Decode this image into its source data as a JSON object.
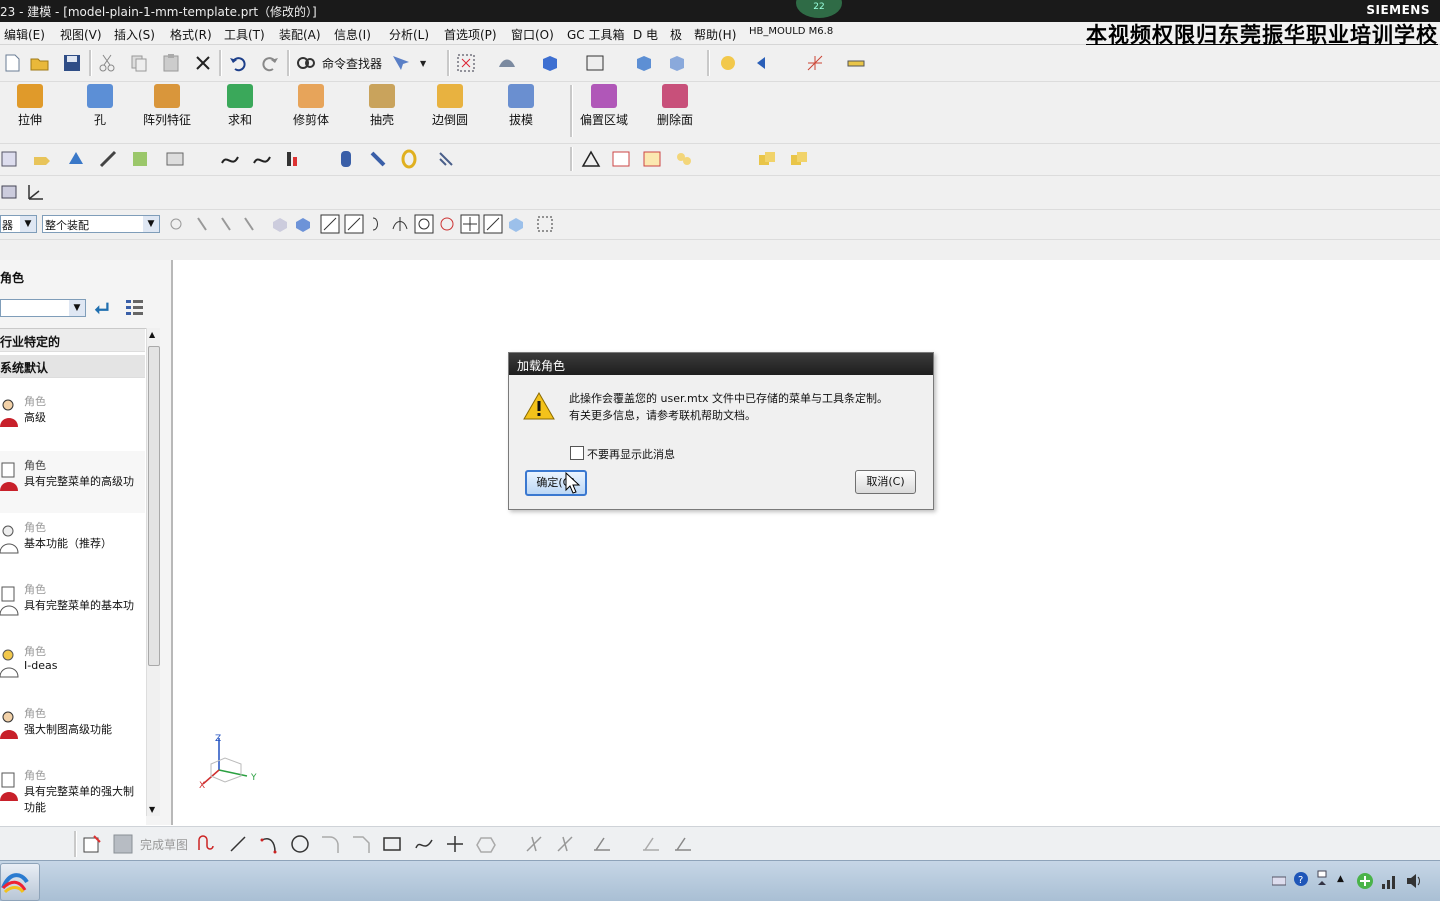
{
  "window": {
    "title": "23 - 建模 - [model-plain-1-mm-template.prt（修改的）]",
    "brand": "SIEMENS",
    "orb_badge": "22"
  },
  "watermark": "本视频权限归东莞振华职业培训学校",
  "menu": [
    "编辑(E)",
    "视图(V)",
    "插入(S)",
    "格式(R)",
    "工具(T)",
    "装配(A)",
    "信息(I)",
    "分析(L)",
    "首选项(P)",
    "窗口(O)",
    "GC 工具箱",
    "D 电",
    "极",
    "帮助(H)",
    "HB_MOULD M6.8"
  ],
  "standard_toolbar": {
    "command_finder_label": "命令查找器"
  },
  "feature_toolbar": [
    {
      "label": "拉伸",
      "color": "#e09a2a"
    },
    {
      "label": "孔",
      "color": "#5c8fd6"
    },
    {
      "label": "阵列特征",
      "color": "#d9963b"
    },
    {
      "label": "求和",
      "color": "#3aa85a"
    },
    {
      "label": "修剪体",
      "color": "#e7a45a"
    },
    {
      "label": "抽壳",
      "color": "#c9a35c"
    },
    {
      "label": "边倒圆",
      "color": "#e8b240"
    },
    {
      "label": "拔模",
      "color": "#6a8fd0"
    },
    {
      "label": "偏置区域",
      "color": "#b057b8"
    },
    {
      "label": "删除面",
      "color": "#c8507a"
    }
  ],
  "selection_bar": {
    "filter_value": "器",
    "scope_value": "整个装配"
  },
  "nav_panel": {
    "title": "角色",
    "groups": [
      "行业特定的",
      "系统默认"
    ],
    "category": "角色",
    "items": [
      {
        "category": "角色",
        "name": "高级"
      },
      {
        "category": "角色",
        "name": "具有完整菜单的高级功"
      },
      {
        "category": "角色",
        "name": "基本功能（推荐）"
      },
      {
        "category": "角色",
        "name": "具有完整菜单的基本功"
      },
      {
        "category": "角色",
        "name": "I-deas"
      },
      {
        "category": "角色",
        "name": "强大制图高级功能"
      },
      {
        "category": "角色",
        "name": "具有完整菜单的强大制",
        "name2": "功能"
      }
    ]
  },
  "triad": {
    "z": "Z",
    "y": "Y",
    "x": "X"
  },
  "sketch_toolbar": {
    "finish_label": "完成草图"
  },
  "dialog": {
    "title": "加载角色",
    "message_line1": "此操作会覆盖您的 user.mtx 文件中已存储的菜单与工具条定制。",
    "message_line2": "有关更多信息，请参考联机帮助文档。",
    "checkbox_label": "不要再显示此消息",
    "checkbox_checked": false,
    "ok_label": "确定(O)",
    "cancel_label": "取消(C)"
  }
}
